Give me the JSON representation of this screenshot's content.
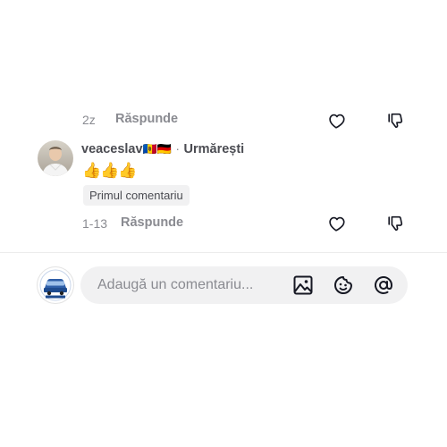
{
  "comments": [
    {
      "time": "2z",
      "reply_label": "Răspunde"
    },
    {
      "username": "veaceslav",
      "flags": [
        "🇲🇩",
        "🇩🇪"
      ],
      "separator": "·",
      "follow_label": "Urmărești",
      "text": "👍👍👍",
      "badge": "Primul comentariu",
      "time": "1-13",
      "reply_label": "Răspunde"
    }
  ],
  "composer": {
    "placeholder": "Adaugă un comentariu...",
    "icons": [
      "image-icon",
      "emoji-icon",
      "mention-icon"
    ]
  },
  "colors": {
    "muted": "#8a8b91",
    "input_bg": "#f1f1f2",
    "text": "#161823"
  }
}
